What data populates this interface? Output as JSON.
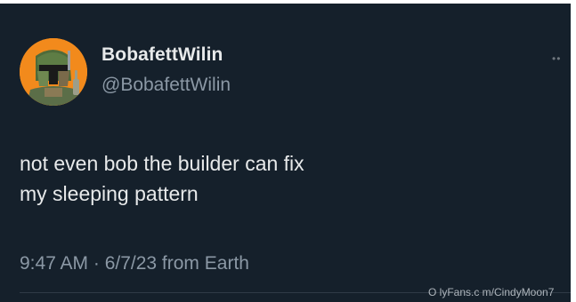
{
  "user": {
    "display_name": "BobafettWilin",
    "handle": "@BobafettWilin",
    "avatar_icon": "boba-fett-helmet-avatar"
  },
  "more_icon": "more-options-icon",
  "tweet": {
    "line1": "not even bob the builder can fix",
    "line2": "my sleeping pattern"
  },
  "meta": {
    "timestamp": "9:47 AM · 6/7/23 from Earth"
  },
  "watermark": "O lyFans.c m/CindyMoon7",
  "colors": {
    "background": "#15202b",
    "primary_text": "#e7e9ea",
    "secondary_text": "#8b98a5",
    "avatar_bg": "#f28a1c"
  }
}
